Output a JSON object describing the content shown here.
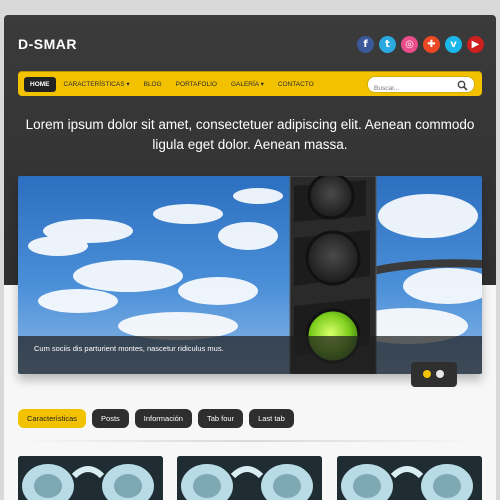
{
  "header": {
    "logo": "D-SMAR",
    "social_icons": [
      "facebook-icon",
      "twitter-icon",
      "dribbble-icon",
      "stumbleupon-icon",
      "vimeo-icon",
      "youtube-icon"
    ]
  },
  "nav": {
    "items": [
      {
        "label": "HOME",
        "active": true
      },
      {
        "label": "CARACTERÍSTICAS ▾"
      },
      {
        "label": "BLOG"
      },
      {
        "label": "PORTAFOLIO"
      },
      {
        "label": "GALERÍA ▾"
      },
      {
        "label": "CONTACTO"
      }
    ],
    "search_placeholder": "Buscar..."
  },
  "headline": "Lorem ipsum dolor sit amet, consectetuer adipiscing elit. Aenean commodo ligula eget dolor. Aenean massa.",
  "slider": {
    "caption": "Cum sociis dis parturient montes, nascetur ridiculus mus.",
    "active_dot": 1,
    "dot_count": 2
  },
  "tabs": [
    {
      "label": "Características",
      "active": true
    },
    {
      "label": "Posts"
    },
    {
      "label": "Información"
    },
    {
      "label": "Tab four"
    },
    {
      "label": "Last tab"
    }
  ],
  "colors": {
    "accent": "#f2c200",
    "dark": "#2f2f2f"
  }
}
